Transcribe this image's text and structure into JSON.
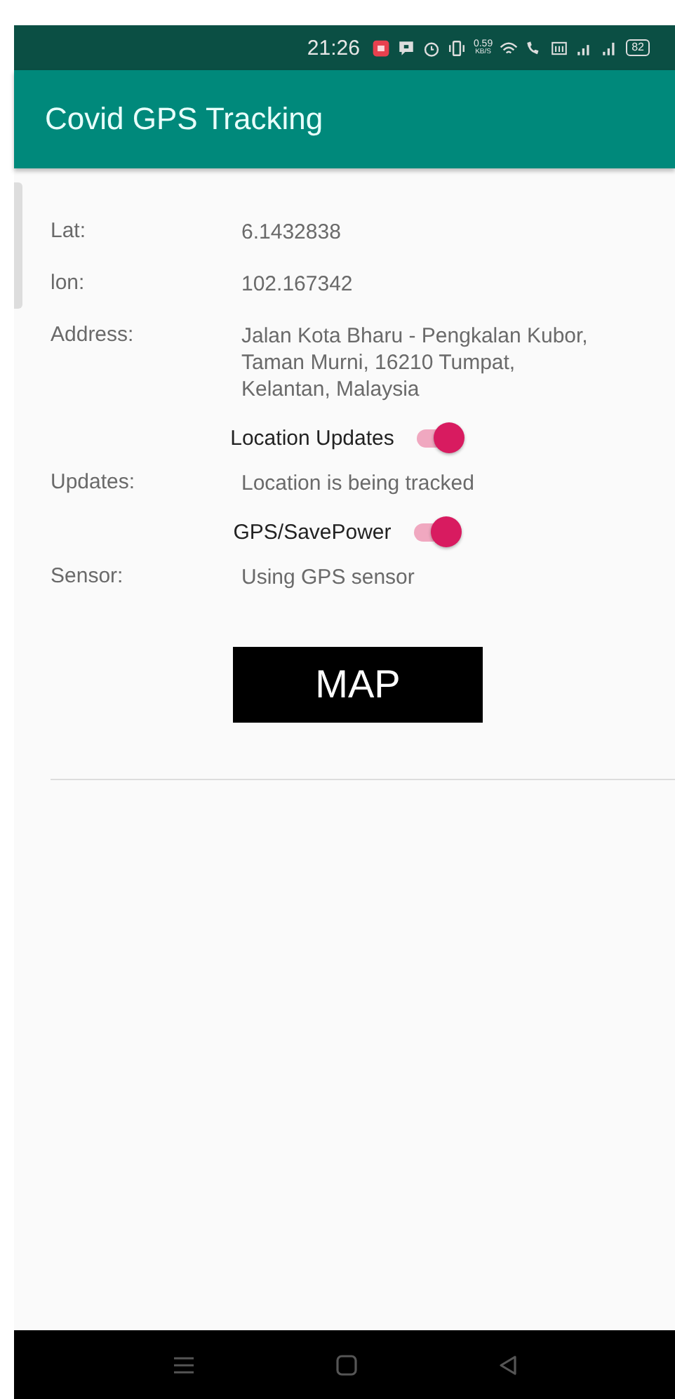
{
  "status_bar": {
    "time": "21:26",
    "speed": "0.59",
    "speed_unit": "KB/S",
    "battery": "82"
  },
  "app_bar": {
    "title": "Covid GPS Tracking"
  },
  "rows": [
    {
      "kind": "field",
      "label": "Lat:",
      "value": "6.1432838"
    },
    {
      "kind": "field",
      "label": "lon:",
      "value": "102.167342"
    },
    {
      "kind": "field",
      "label": "Address:",
      "value": "Jalan Kota Bharu - Pengkalan Kubor, Taman Murni, 16210 Tumpat, Kelantan, Malaysia"
    },
    {
      "kind": "switch",
      "label": "Location Updates",
      "on": true
    },
    {
      "kind": "field",
      "label": "Updates:",
      "value": "Location is being tracked"
    },
    {
      "kind": "switch",
      "label": "GPS/SavePower",
      "on": true
    },
    {
      "kind": "field",
      "label": "Sensor:",
      "value": "Using GPS sensor"
    }
  ],
  "button": {
    "label": "MAP"
  }
}
